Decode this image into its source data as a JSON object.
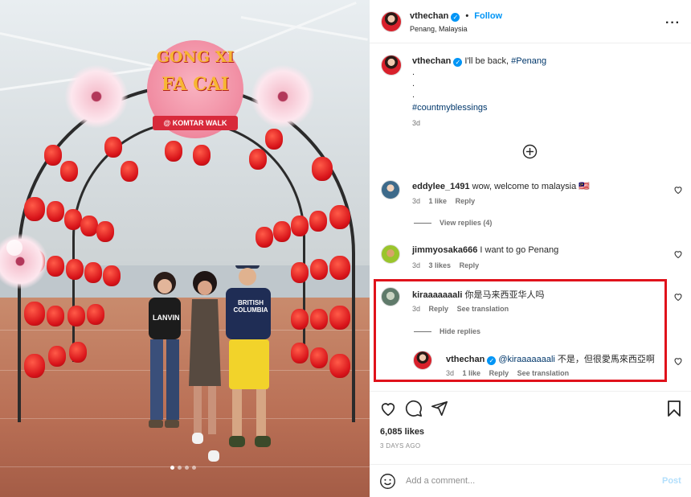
{
  "post": {
    "author": "vthechan",
    "follow_label": "Follow",
    "location": "Penang, Malaysia",
    "caption_user": "vthechan",
    "caption_text": "I'll be back, ",
    "caption_tag": "#Penang",
    "caption_dots": [
      ".",
      ".",
      "."
    ],
    "caption_hashtag": "#countmyblessings",
    "caption_time": "3d",
    "likes": "6,085 likes",
    "posted": "3 DAYS AGO",
    "add_comment_placeholder": "Add a comment...",
    "post_label": "Post"
  },
  "image": {
    "sign_line1": "GONG XI",
    "sign_line2": "FA CAI",
    "sign_banner": "@ KOMTAR WALK",
    "shirt1_text": "LANVIN",
    "shirt3_text": "BRITISH COLUMBIA",
    "slide_count": 4,
    "active_slide": 1
  },
  "comments": [
    {
      "user": "eddylee_1491",
      "text": "wow, welcome to malaysia 🇲🇾",
      "time": "3d",
      "likes": "1 like",
      "reply": "Reply",
      "view_replies": "View replies (4)"
    },
    {
      "user": "jimmyosaka666",
      "text": "I want to go Penang",
      "time": "3d",
      "likes": "3 likes",
      "reply": "Reply"
    },
    {
      "user": "kiraaaaaaali",
      "text": "你是马来西亚华人吗",
      "time": "3d",
      "reply": "Reply",
      "see_translation": "See translation",
      "hide_replies": "Hide replies"
    }
  ],
  "reply": {
    "user": "vthechan",
    "mention": "@kiraaaaaaali",
    "text": " 不是，但很愛馬來西亞啊",
    "time": "3d",
    "likes": "1 like",
    "reply": "Reply",
    "see_translation": "See translation"
  },
  "colors": {
    "accent_blue": "#0095f6",
    "highlight_red": "#e0121b",
    "lantern_red": "#d8141a"
  }
}
